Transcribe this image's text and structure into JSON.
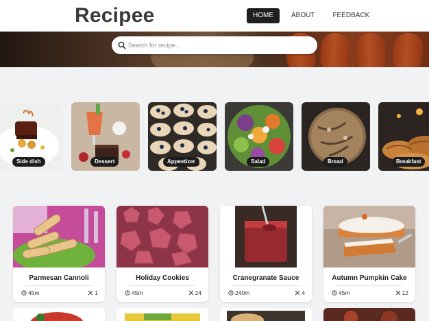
{
  "header": {
    "logo": "Recipee",
    "nav": [
      {
        "label": "HOME",
        "active": true
      },
      {
        "label": "ABOUT",
        "active": false
      },
      {
        "label": "FEEDBACK",
        "active": false
      }
    ]
  },
  "search": {
    "placeholder": "Search for recipe...",
    "value": "",
    "icon": "search-icon"
  },
  "categories": [
    {
      "label": "Side dish"
    },
    {
      "label": "Dessert"
    },
    {
      "label": "Appeetizer"
    },
    {
      "label": "Salad"
    },
    {
      "label": "Bread"
    },
    {
      "label": "Breakfast"
    }
  ],
  "recipes": [
    {
      "title": "Parmesan Cannoli",
      "time": "45m",
      "servings": "1"
    },
    {
      "title": "Holiday Cookies",
      "time": "45m",
      "servings": "24"
    },
    {
      "title": "Cranegranate Sauce",
      "time": "240m",
      "servings": "4"
    },
    {
      "title": "Autumn Pumpkin Cake",
      "time": "45m",
      "servings": "12"
    }
  ],
  "icons": {
    "time": "clock-icon",
    "servings": "utensils-icon"
  },
  "colors": {
    "nav_active_bg": "#1f1f1f",
    "label_bg": "#1c1c1c",
    "page_bg": "#f1f2f4"
  }
}
